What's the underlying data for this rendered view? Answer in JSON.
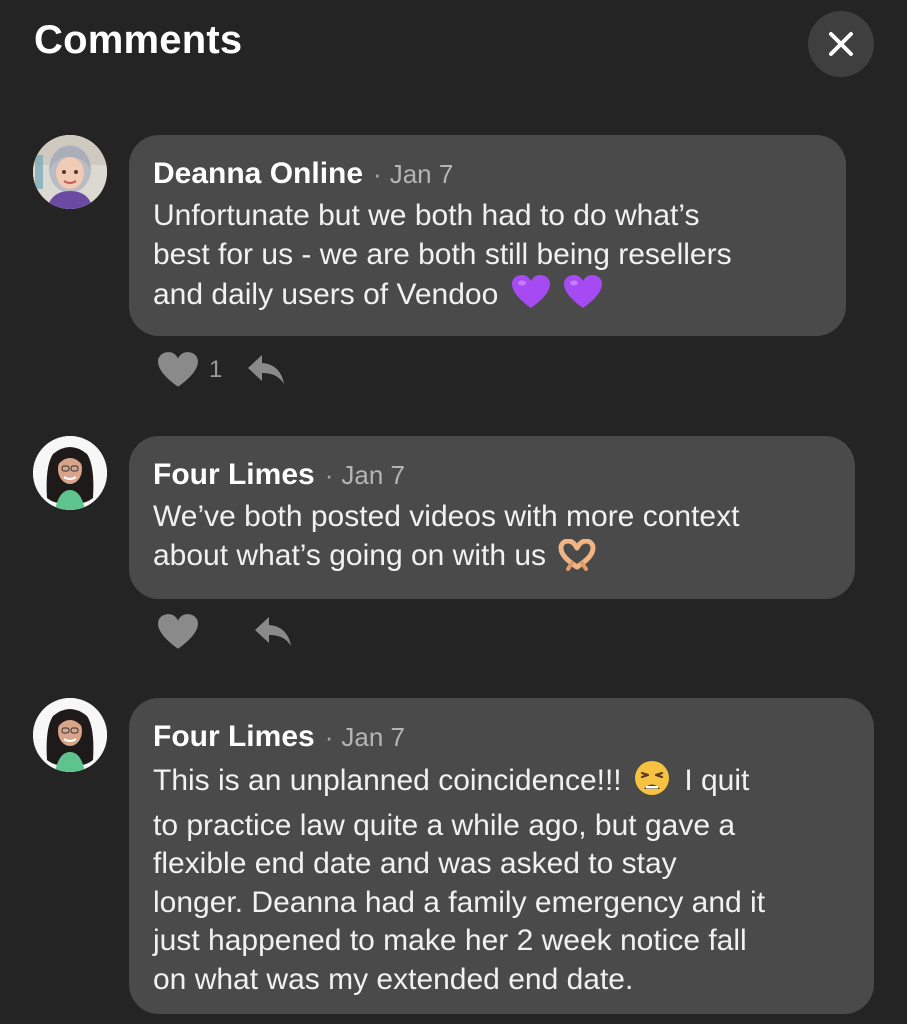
{
  "header": {
    "title": "Comments",
    "close_icon": "close-icon"
  },
  "comments": [
    {
      "author": "Deanna Online",
      "separator": "·",
      "date": "Jan 7",
      "lines": [
        "Unfortunate but we both had to do what’s",
        "best for us - we are both still being resellers",
        "and daily users of Vendoo"
      ],
      "emojis": [
        "purple-heart-icon",
        "purple-heart-icon"
      ],
      "likes": "1",
      "avatar_icon": "avatar-deanna"
    },
    {
      "author": "Four Limes",
      "separator": "·",
      "date": "Jan 7",
      "lines": [
        "We’ve both posted videos with more context",
        "about what’s going on with us"
      ],
      "emojis": [
        "heart-hands-icon"
      ],
      "likes": "",
      "avatar_icon": "avatar-four-limes"
    },
    {
      "author": "Four Limes",
      "separator": "·",
      "date": "Jan 7",
      "line1_before": "This is an unplanned coincidence!!!",
      "line1_after": "I quit",
      "lines": [
        "to practice law quite a while ago, but gave a",
        "flexible end date and was asked to stay",
        "longer. Deanna had a family emergency and it",
        "just happened to make her 2 week notice fall",
        "on what was my extended end date."
      ],
      "emojis": [
        "tired-face-icon"
      ],
      "likes": "",
      "avatar_icon": "avatar-four-limes"
    }
  ],
  "colors": {
    "background": "#242424",
    "bubble": "#4a4a4a",
    "icon": "#8a8a8a",
    "purple_heart": "#a64bf4"
  }
}
